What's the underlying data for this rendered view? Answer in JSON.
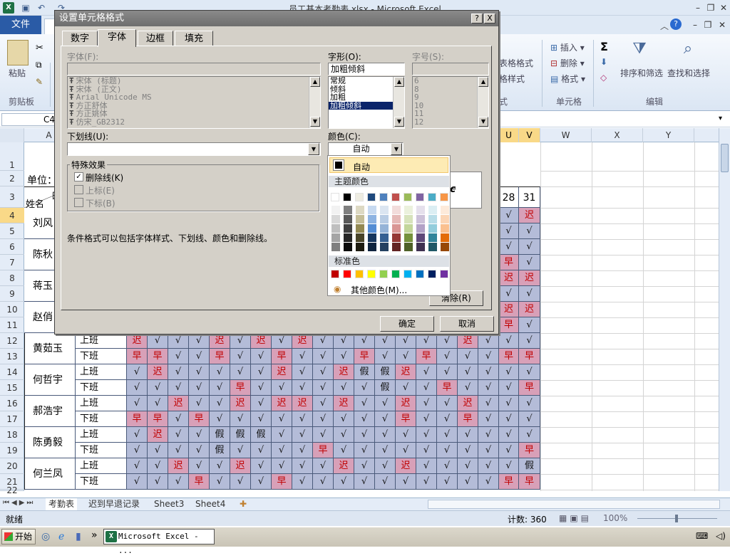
{
  "window": {
    "title": "员工基本考勤表.xlsx - Microsoft Excel"
  },
  "ribbon": {
    "file_tab": "文件",
    "partial_tab": "开",
    "groups": {
      "clipboard": "剪贴板",
      "styles_partial": "式",
      "cells": "单元格",
      "editing": "编辑"
    },
    "paste_label": "粘贴",
    "cond_format_partial": "表格格式",
    "cell_style_partial": "格样式",
    "insert_label": "插入",
    "delete_label": "删除",
    "format_label": "格式",
    "sort_label": "排序和筛选",
    "find_label": "查找和选择",
    "sigma": "Σ"
  },
  "name_box": "C4",
  "columns": [
    "A",
    "U",
    "V",
    "W",
    "X",
    "Y"
  ],
  "rows": [
    "1",
    "2",
    "3",
    "4",
    "5",
    "6",
    "7",
    "8",
    "9",
    "10",
    "11",
    "12",
    "13",
    "14",
    "15",
    "16",
    "17",
    "18",
    "19",
    "20",
    "21",
    "22"
  ],
  "sheet": {
    "unit_label": "单位：",
    "day_header_partial": "日",
    "name_header": "姓名",
    "day28": "28",
    "day31": "31",
    "names_left": [
      "刘风",
      "陈秋",
      "蒋玉",
      "赵俏"
    ],
    "employees": [
      {
        "name": "黄茹玉",
        "on": "上班",
        "off": "下班",
        "r1": [
          "迟",
          "√",
          "√",
          "√",
          "迟",
          "√",
          "迟",
          "√",
          "迟",
          "√",
          "√",
          "√",
          "√",
          "√",
          "√",
          "√",
          "迟",
          "√",
          "√",
          "√"
        ],
        "r2": [
          "早",
          "早",
          "√",
          "√",
          "早",
          "√",
          "√",
          "早",
          "√",
          "√",
          "√",
          "早",
          "√",
          "√",
          "早",
          "√",
          "√",
          "√",
          "早",
          "早"
        ]
      },
      {
        "name": "何哲宇",
        "on": "上班",
        "off": "下班",
        "r1": [
          "√",
          "迟",
          "√",
          "√",
          "√",
          "√",
          "√",
          "迟",
          "√",
          "√",
          "迟",
          "假",
          "假",
          "迟",
          "√",
          "√",
          "√",
          "√",
          "√",
          "√"
        ],
        "r2": [
          "√",
          "√",
          "√",
          "√",
          "√",
          "早",
          "√",
          "√",
          "√",
          "√",
          "√",
          "√",
          "假",
          "√",
          "√",
          "早",
          "√",
          "√",
          "√",
          "早"
        ]
      },
      {
        "name": "郝浩宇",
        "on": "上班",
        "off": "下班",
        "r1": [
          "√",
          "√",
          "迟",
          "√",
          "√",
          "迟",
          "√",
          "迟",
          "迟",
          "√",
          "迟",
          "√",
          "√",
          "迟",
          "√",
          "√",
          "迟",
          "√",
          "√",
          "√"
        ],
        "r2": [
          "早",
          "早",
          "√",
          "早",
          "√",
          "√",
          "√",
          "√",
          "√",
          "√",
          "√",
          "√",
          "√",
          "早",
          "√",
          "√",
          "早",
          "√",
          "√",
          "√"
        ]
      },
      {
        "name": "陈勇毅",
        "on": "上班",
        "off": "下班",
        "r1": [
          "√",
          "迟",
          "√",
          "√",
          "假",
          "假",
          "假",
          "√",
          "√",
          "√",
          "√",
          "√",
          "√",
          "√",
          "√",
          "√",
          "√",
          "√",
          "√",
          "√"
        ],
        "r2": [
          "√",
          "√",
          "√",
          "√",
          "假",
          "√",
          "√",
          "√",
          "√",
          "早",
          "√",
          "√",
          "√",
          "√",
          "√",
          "√",
          "√",
          "√",
          "√",
          "早"
        ]
      },
      {
        "name": "何兰凤",
        "on": "上班",
        "off": "下班",
        "r1": [
          "√",
          "√",
          "迟",
          "√",
          "√",
          "迟",
          "√",
          "√",
          "√",
          "√",
          "迟",
          "√",
          "√",
          "迟",
          "√",
          "√",
          "√",
          "√",
          "√",
          "假"
        ],
        "r2": [
          "√",
          "√",
          "√",
          "早",
          "√",
          "√",
          "√",
          "早",
          "√",
          "√",
          "√",
          "√",
          "√",
          "√",
          "√",
          "√",
          "√",
          "√",
          "早",
          "早"
        ]
      }
    ],
    "uv_rows": [
      [
        "√",
        "迟"
      ],
      [
        "√",
        "√"
      ],
      [
        "√",
        "√"
      ],
      [
        "早",
        "√"
      ],
      [
        "迟",
        "迟"
      ],
      [
        "√",
        "√"
      ],
      [
        "迟",
        "迟"
      ],
      [
        "早",
        "√"
      ]
    ]
  },
  "sheet_tabs": [
    "考勤表",
    "迟到早退记录",
    "Sheet3",
    "Sheet4"
  ],
  "status": {
    "ready": "就绪",
    "count": "计数: 360",
    "zoom": "100%"
  },
  "taskbar": {
    "start": "开始",
    "item": "Microsoft Excel - ..."
  },
  "dialog": {
    "title": "设置单元格格式",
    "help": "?",
    "close": "X",
    "tabs": [
      "数字",
      "字体",
      "边框",
      "填充"
    ],
    "font_label": "字体(F):",
    "font_value": "",
    "font_list": [
      "宋体 (标题)",
      "宋体 (正文)",
      "Arial Unicode MS",
      "方正舒体",
      "方正姚体",
      "仿宋_GB2312"
    ],
    "style_label": "字形(O):",
    "style_value": "加粗倾斜",
    "style_list": [
      "常规",
      "倾斜",
      "加粗",
      "加粗倾斜"
    ],
    "size_label": "字号(S):",
    "size_value": "",
    "size_list": [
      "6",
      "8",
      "9",
      "10",
      "11",
      "12"
    ],
    "underline_label": "下划线(U):",
    "underline_value": "",
    "color_label": "颜色(C):",
    "color_value": "自动",
    "effects_label": "特殊效果",
    "strike_label": "删除线(K)",
    "super_label": "上标(E)",
    "sub_label": "下标(B)",
    "preview_text": "c",
    "note": "条件格式可以包括字体样式、下划线、颜色和删除线。",
    "clear_button": "清除(R)",
    "ok_button": "确定",
    "cancel_button": "取消"
  },
  "color_popup": {
    "auto_label": "自动",
    "theme_label": "主题颜色",
    "standard_label": "标准色",
    "more_label": "其他颜色(M)...",
    "theme_top": [
      "#ffffff",
      "#000000",
      "#eeece1",
      "#1f497d",
      "#4f81bd",
      "#c0504d",
      "#9bbb59",
      "#8064a2",
      "#4bacc6",
      "#f79646"
    ],
    "theme_shades": [
      [
        "#f2f2f2",
        "#808080",
        "#ddd9c3",
        "#c6d9f0",
        "#dbe5f1",
        "#f2dcdb",
        "#ebf1dd",
        "#e5e0ec",
        "#dbeef3",
        "#fdeada"
      ],
      [
        "#d8d8d8",
        "#595959",
        "#c4bd97",
        "#8db3e2",
        "#b8cce4",
        "#e5b9b7",
        "#d7e3bc",
        "#ccc1d9",
        "#b7dde8",
        "#fbd5b5"
      ],
      [
        "#bfbfbf",
        "#3f3f3f",
        "#938953",
        "#548dd4",
        "#95b3d7",
        "#d99694",
        "#c3d69b",
        "#b2a2c7",
        "#92cddc",
        "#fac08f"
      ],
      [
        "#a5a5a5",
        "#262626",
        "#494429",
        "#17365d",
        "#366092",
        "#953734",
        "#76923c",
        "#5f497a",
        "#31859b",
        "#e36c09"
      ],
      [
        "#7f7f7f",
        "#0c0c0c",
        "#1d1b10",
        "#0f243e",
        "#244061",
        "#632423",
        "#4f6128",
        "#3f3151",
        "#205867",
        "#974806"
      ]
    ],
    "standard": [
      "#c00000",
      "#ff0000",
      "#ffc000",
      "#ffff00",
      "#92d050",
      "#00b050",
      "#00b0f0",
      "#0070c0",
      "#002060",
      "#7030a0"
    ]
  }
}
